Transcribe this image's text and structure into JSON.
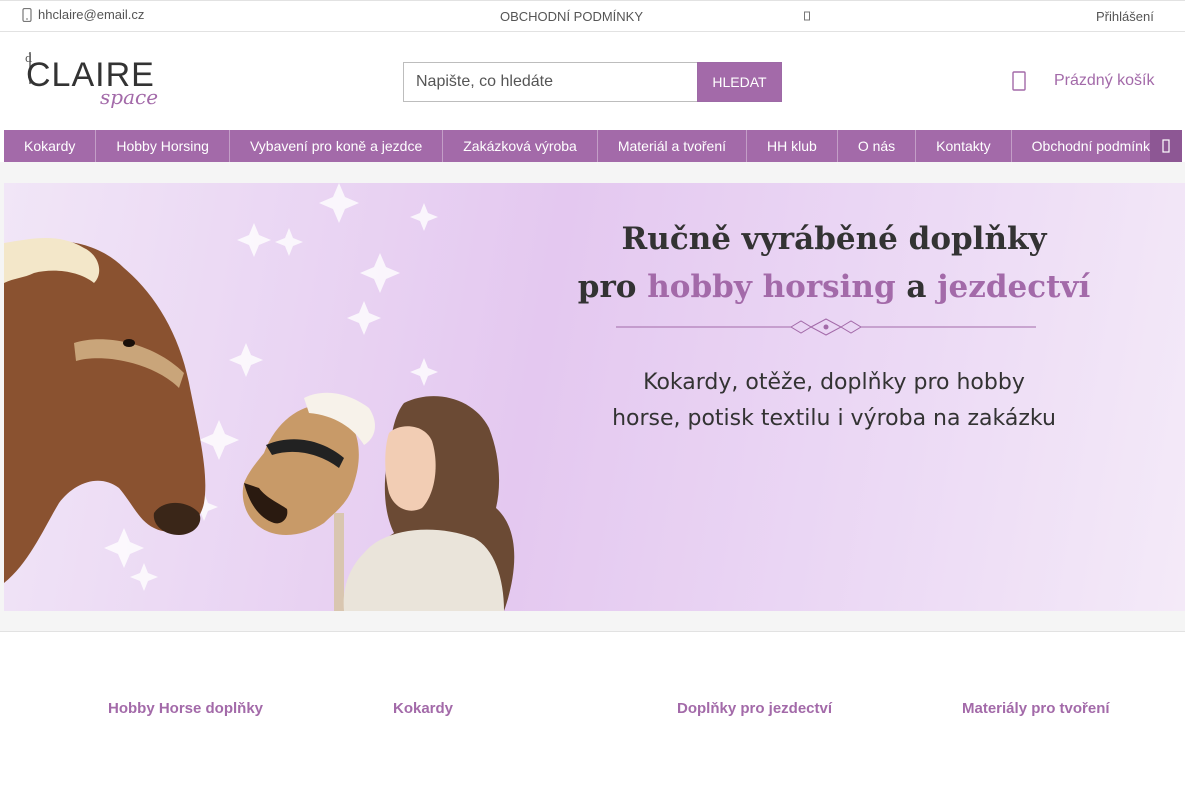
{
  "topbar": {
    "email": "hhclaire@email.cz",
    "terms": "OBCHODNÍ PODMÍNKY",
    "login": "Přihlášení"
  },
  "header": {
    "logo_main": "CLAIRE",
    "logo_script": "space",
    "logo_small": "d"
  },
  "search": {
    "placeholder": "Napište, co hledáte",
    "button": "HLEDAT"
  },
  "cart": {
    "label": "Prázdný košík"
  },
  "nav": {
    "items": [
      "Kokardy",
      "Hobby Horsing",
      "Vybavení pro koně a jezdce",
      "Zakázková výroba",
      "Materiál a tvoření",
      "HH klub",
      "O nás",
      "Kontakty",
      "Obchodní podmínky"
    ]
  },
  "hero": {
    "line1": "Ručně vyráběné doplňky",
    "line2_a": "pro ",
    "line2_b": "hobby horsing",
    "line2_c": " a ",
    "line2_d": "jezdectví",
    "sub1": "Kokardy, otěže, doplňky pro hobby",
    "sub2": "horse, potisk textilu i výroba na zakázku"
  },
  "categories": [
    "Hobby Horse doplňky",
    "Kokardy",
    "Doplňky pro jezdectví",
    "Materiály pro tvoření"
  ],
  "colors": {
    "accent": "#a36aa9"
  }
}
